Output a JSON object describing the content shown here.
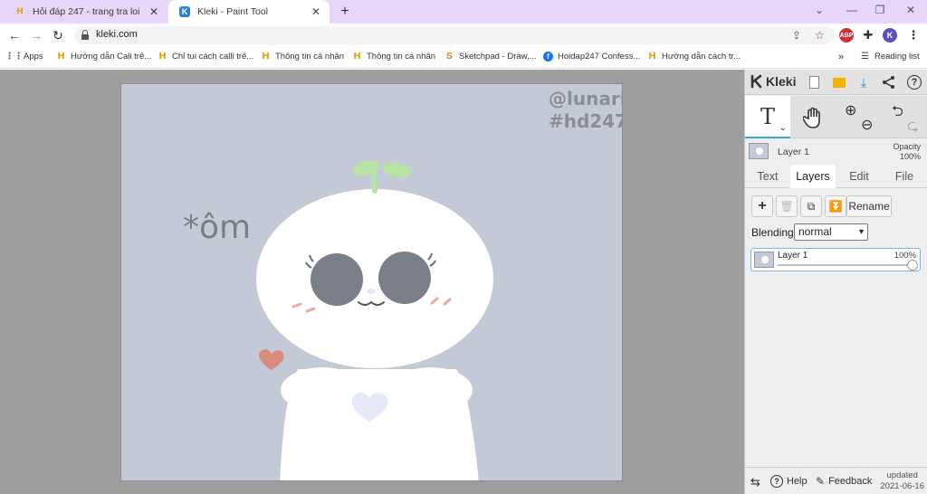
{
  "browser": {
    "tabs": [
      {
        "title": "Hỏi đáp 247 - trang tra loi"
      },
      {
        "title": "Kleki - Paint Tool"
      }
    ],
    "url": "kleki.com",
    "profile_initial": "K",
    "abp_label": "ABP"
  },
  "bookmarks": {
    "apps": "Apps",
    "items": [
      {
        "label": "Hướng dẫn Cali trê..."
      },
      {
        "label": "Chỉ tui cách calli trê..."
      },
      {
        "label": "Thông tin cá nhân"
      },
      {
        "label": "Thông tin cá nhân"
      },
      {
        "label": "Sketchpad - Draw,..."
      },
      {
        "label": "Hoidap247 Confess..."
      },
      {
        "label": "Hướng dẫn cách tr..."
      }
    ],
    "more": "»",
    "reading_list": "Reading list"
  },
  "canvas": {
    "watermark_handle": "@lunarie",
    "watermark_tag": "#hd247",
    "caption": "*ôm",
    "colors": {
      "background": "#c4c9d8",
      "character": "#ffffff",
      "eyes": "#7b7f8a",
      "sprout": "#b6e3a4",
      "heart_small": "#d98b80",
      "heart_body": "#e6eaf8"
    }
  },
  "app": {
    "name": "Kleki",
    "layer_name": "Layer 1",
    "opacity_label": "Opacity",
    "opacity_value": "100%",
    "tabs": [
      "Text",
      "Layers",
      "Edit",
      "File"
    ],
    "active_tab": "Layers",
    "rename_label": "Rename",
    "blending_label": "Blending",
    "blending_value": "normal",
    "layers": [
      {
        "name": "Layer 1",
        "opacity": "100%"
      }
    ],
    "footer": {
      "help": "Help",
      "feedback": "Feedback",
      "updated_label": "updated",
      "updated_date": "2021-06-16"
    },
    "accent": "#3ea0e0"
  }
}
